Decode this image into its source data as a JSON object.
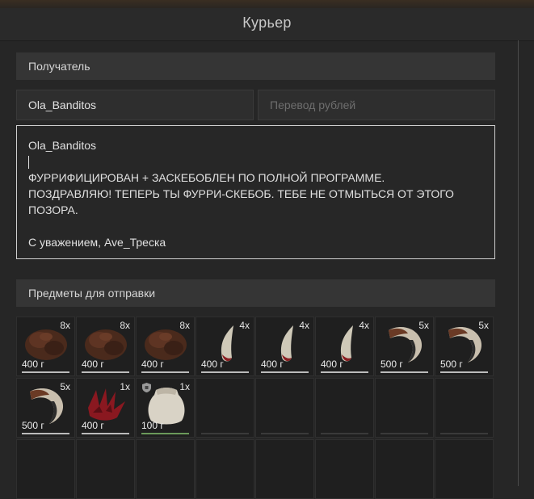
{
  "window": {
    "title": "Курьер"
  },
  "recipient_section": {
    "header": "Получатель"
  },
  "fields": {
    "recipient_value": "Ola_Banditos",
    "transfer_placeholder": "Перевод рублей"
  },
  "message": {
    "lines": [
      "Ola_Banditos",
      "",
      "ФУРРИФИЦИРОВАН + ЗАСКЕБОБЛЕН ПО ПОЛНОЙ ПРОГРАММЕ.",
      "ПОЗДРАВЛЯЮ! ТЕПЕРЬ ТЫ ФУРРИ-СКЕБОБ. ТЕБЕ НЕ ОТМЫТЬСЯ ОТ ЭТОГО",
      "ПОЗОРА.",
      "",
      "С уважением, Ave_Треска"
    ]
  },
  "items_section": {
    "header": "Предметы для отправки"
  },
  "items": [
    {
      "icon": "fur-pelt-icon",
      "qty": "8x",
      "weight": "400 г"
    },
    {
      "icon": "fur-pelt-icon",
      "qty": "8x",
      "weight": "400 г"
    },
    {
      "icon": "fur-pelt-icon",
      "qty": "8x",
      "weight": "400 г"
    },
    {
      "icon": "white-fang-icon",
      "qty": "4x",
      "weight": "400 г"
    },
    {
      "icon": "white-fang-icon",
      "qty": "4x",
      "weight": "400 г"
    },
    {
      "icon": "white-fang-icon",
      "qty": "4x",
      "weight": "400 г"
    },
    {
      "icon": "curved-horn-icon",
      "qty": "5x",
      "weight": "500 г"
    },
    {
      "icon": "curved-horn-icon",
      "qty": "5x",
      "weight": "500 г"
    },
    {
      "icon": "curved-horn-icon",
      "qty": "5x",
      "weight": "500 г"
    },
    {
      "icon": "red-spikes-icon",
      "qty": "1x",
      "weight": "400 г"
    },
    {
      "icon": "sack-icon",
      "qty": "1x",
      "weight": "100 г",
      "locked": true
    }
  ],
  "colors": {
    "accent_border": "#cfcfcf",
    "sack_bar": "#6b9a5a"
  }
}
